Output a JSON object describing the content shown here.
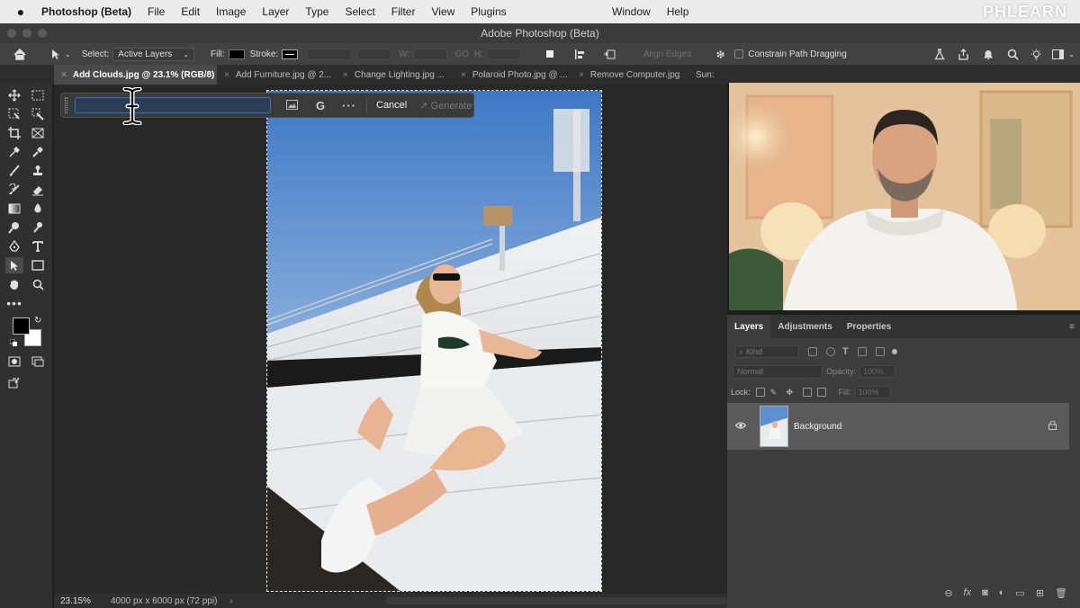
{
  "menubar": {
    "app_name": "Photoshop (Beta)",
    "menus": [
      "File",
      "Edit",
      "Image",
      "Layer",
      "Type",
      "Select",
      "Filter",
      "View",
      "Plugins"
    ],
    "right_menus": [
      "Window",
      "Help"
    ],
    "logo_text": "PHLEARN"
  },
  "window": {
    "title": "Adobe Photoshop (Beta)"
  },
  "options_bar": {
    "select_label": "Select:",
    "select_value": "Active Layers",
    "fill_label": "Fill:",
    "stroke_label": "Stroke:",
    "w_label": "W:",
    "h_label": "H:",
    "link_glyph": "GO",
    "align_edges_label": "Align Edges",
    "constrain_label": "Constrain Path Dragging"
  },
  "tabs": [
    {
      "label": "Add Clouds.jpg @ 23.1% (RGB/8) *",
      "active": true
    },
    {
      "label": "Add Furniture.jpg @ 2...",
      "active": false
    },
    {
      "label": "Change Lighting.jpg ...",
      "active": false
    },
    {
      "label": "Polaroid Photo.jpg @ ...",
      "active": false
    },
    {
      "label": "Remove Computer.jpg",
      "active": false
    },
    {
      "label": "Sun:",
      "active": false
    }
  ],
  "taskbar": {
    "prompt_value": "",
    "cancel_label": "Cancel",
    "generate_label": "Generate"
  },
  "status": {
    "zoom": "23.15%",
    "doc_size": "4000 px x 6000 px (72 ppi)",
    "arrow": "›"
  },
  "layers_panel": {
    "tabs": [
      "Layers",
      "Adjustments",
      "Properties"
    ],
    "kind_label": "Kind",
    "blend_mode": "Normal",
    "opacity_label": "Opacity:",
    "opacity_value": "100%",
    "lock_label": "Lock:",
    "fill_label": "Fill:",
    "fill_value": "100%",
    "layers": [
      {
        "name": "Background"
      }
    ]
  }
}
